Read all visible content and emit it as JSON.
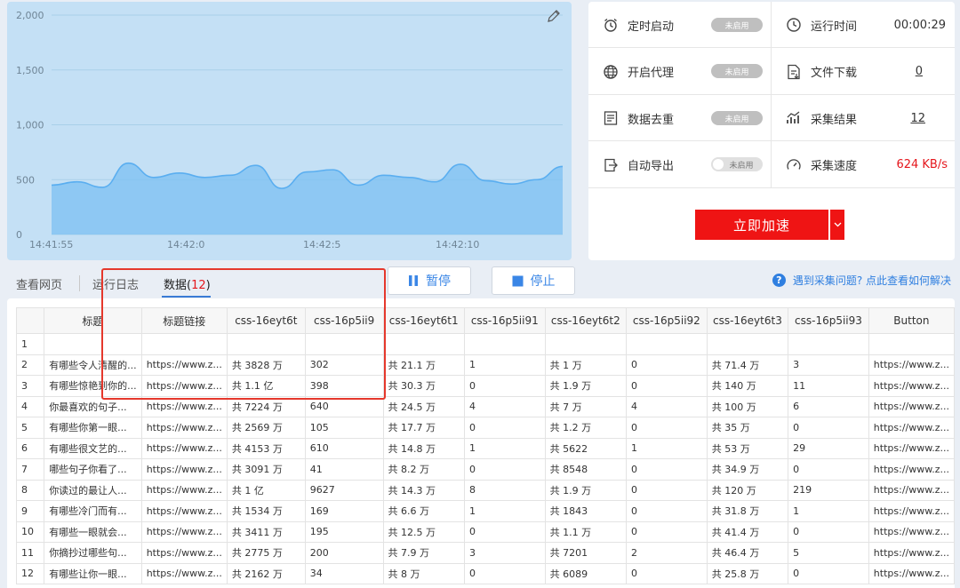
{
  "chart": {
    "y_ticks": [
      "2,000",
      "1,500",
      "1,000",
      "500",
      "0"
    ],
    "x_ticks": [
      "14:41:55",
      "14:42:0",
      "14:42:5",
      "14:42:10"
    ]
  },
  "chart_data": {
    "type": "area",
    "title": "",
    "xlabel": "",
    "ylabel": "",
    "ylim": [
      0,
      2000
    ],
    "x_tick_labels": [
      "14:41:55",
      "14:42:0",
      "14:42:5",
      "14:42:10"
    ],
    "grid": true,
    "color": "#5aaef0",
    "series": [
      {
        "x": [
          0,
          1,
          2,
          3,
          4,
          5,
          6,
          7,
          8,
          9,
          10,
          11,
          12,
          13,
          14,
          15,
          16,
          17,
          18,
          19,
          20
        ],
        "values": [
          450,
          480,
          430,
          650,
          520,
          560,
          520,
          540,
          630,
          420,
          570,
          590,
          450,
          540,
          520,
          480,
          640,
          490,
          460,
          500,
          620
        ]
      }
    ]
  },
  "stats": {
    "scheduled": {
      "label": "定时启动",
      "status": "未启用",
      "icon": "alarm-clock-icon"
    },
    "runtime": {
      "label": "运行时间",
      "value": "00:00:29",
      "icon": "clock-icon"
    },
    "proxy": {
      "label": "开启代理",
      "status": "未启用",
      "icon": "globe-icon"
    },
    "download": {
      "label": "文件下载",
      "value": "0",
      "icon": "file-download-icon"
    },
    "dedup": {
      "label": "数据去重",
      "status": "未启用",
      "icon": "document-list-icon"
    },
    "result": {
      "label": "采集结果",
      "value": "12",
      "icon": "trend-chart-icon"
    },
    "export": {
      "label": "自动导出",
      "status": "未启用",
      "icon": "export-icon"
    },
    "speed": {
      "label": "采集速度",
      "value": "624 KB/s",
      "icon": "speedometer-icon"
    }
  },
  "accelerate": {
    "label": "立即加速"
  },
  "tabs": {
    "webpage": "查看网页",
    "log": "运行日志",
    "data_label": "数据(",
    "data_count": "12",
    "data_close": ")"
  },
  "controls": {
    "pause": "暂停",
    "stop": "停止"
  },
  "help": {
    "text": "遇到采集问题? 点此查看如何解决"
  },
  "table": {
    "columns": [
      "",
      "标题",
      "标题链接",
      "css-16eyt6t",
      "css-16p5ii9",
      "css-16eyt6t1",
      "css-16p5ii91",
      "css-16eyt6t2",
      "css-16p5ii92",
      "css-16eyt6t3",
      "css-16p5ii93",
      "Button"
    ],
    "rows": [
      [
        "1",
        "",
        "",
        "",
        "",
        "",
        "",
        "",
        "",
        "",
        "",
        ""
      ],
      [
        "2",
        "有哪些令人清醒的...",
        "https://www.z...",
        "共 3828 万",
        "302",
        "共 21.1 万",
        "1",
        "共 1 万",
        "0",
        "共 71.4 万",
        "3",
        "https://www.z..."
      ],
      [
        "3",
        "有哪些惊艳到你的...",
        "https://www.z...",
        "共 1.1 亿",
        "398",
        "共 30.3 万",
        "0",
        "共 1.9 万",
        "0",
        "共 140 万",
        "11",
        "https://www.z..."
      ],
      [
        "4",
        "你最喜欢的句子...",
        "https://www.z...",
        "共 7224 万",
        "640",
        "共 24.5 万",
        "4",
        "共 7 万",
        "4",
        "共 100 万",
        "6",
        "https://www.z..."
      ],
      [
        "5",
        "有哪些你第一眼...",
        "https://www.z...",
        "共 2569 万",
        "105",
        "共 17.7 万",
        "0",
        "共 1.2 万",
        "0",
        "共 35 万",
        "0",
        "https://www.z..."
      ],
      [
        "6",
        "有哪些很文艺的...",
        "https://www.z...",
        "共 4153 万",
        "610",
        "共 14.8 万",
        "1",
        "共 5622",
        "1",
        "共 53 万",
        "29",
        "https://www.z..."
      ],
      [
        "7",
        "哪些句子你看了...",
        "https://www.z...",
        "共 3091 万",
        "41",
        "共 8.2 万",
        "0",
        "共 8548",
        "0",
        "共 34.9 万",
        "0",
        "https://www.z..."
      ],
      [
        "8",
        "你读过的最让人...",
        "https://www.z...",
        "共 1 亿",
        "9627",
        "共 14.3 万",
        "8",
        "共 1.9 万",
        "0",
        "共 120 万",
        "219",
        "https://www.z..."
      ],
      [
        "9",
        "有哪些冷门而有...",
        "https://www.z...",
        "共 1534 万",
        "169",
        "共 6.6 万",
        "1",
        "共 1843",
        "0",
        "共 31.8 万",
        "1",
        "https://www.z..."
      ],
      [
        "10",
        "有哪些一眼就会...",
        "https://www.z...",
        "共 3411 万",
        "195",
        "共 12.5 万",
        "0",
        "共 1.1 万",
        "0",
        "共 41.4 万",
        "0",
        "https://www.z..."
      ],
      [
        "11",
        "你摘抄过哪些句...",
        "https://www.z...",
        "共 2775 万",
        "200",
        "共 7.9 万",
        "3",
        "共 7201",
        "2",
        "共 46.4 万",
        "5",
        "https://www.z..."
      ],
      [
        "12",
        "有哪些让你一眼...",
        "https://www.z...",
        "共 2162 万",
        "34",
        "共 8 万",
        "0",
        "共 6089",
        "0",
        "共 25.8 万",
        "0",
        "https://www.z..."
      ]
    ]
  }
}
